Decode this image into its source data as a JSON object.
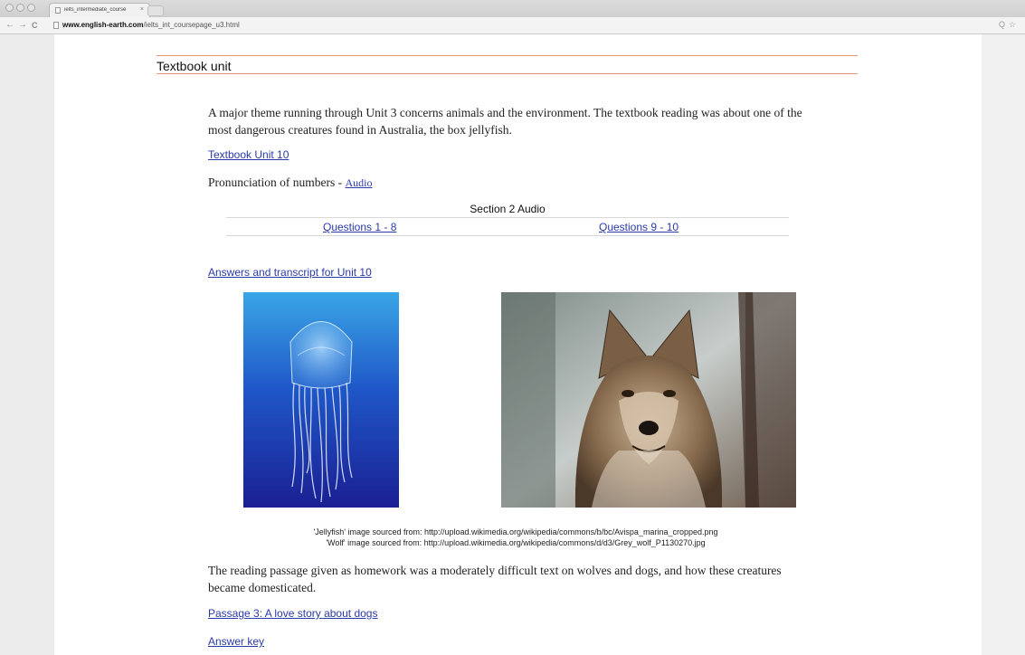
{
  "browser": {
    "tab_title": "ielts_intermediate_course",
    "tab_close": "×",
    "url_host": "www.english-earth.com",
    "url_path": "/ielts_int_coursepage_u3.html",
    "back": "←",
    "forward": "→",
    "reload": "C",
    "zoom": "Q",
    "star": "☆"
  },
  "page": {
    "heading": "Textbook unit",
    "intro": "A major theme running through Unit 3 concerns animals and the environment. The textbook reading was about one of the most dangerous creatures found in Australia, the box jellyfish.",
    "link_textbook": "Textbook Unit 10",
    "pronunciation_label": "Pronunciation of numbers - ",
    "link_audio": "Audio",
    "audio_table": {
      "caption": "Section 2 Audio",
      "cells": [
        "Questions 1 - 8",
        "Questions 9 - 10"
      ]
    },
    "link_answers": "Answers and transcript for Unit 10",
    "credit_jellyfish": "'Jellyfish' image sourced from: http://upload.wikimedia.org/wikipedia/commons/b/bc/Avispa_marina_cropped.png",
    "credit_wolf": "'Wolf' image sourced from: http://upload.wikimedia.org/wikipedia/commons/d/d3/Grey_wolf_P1130270.jpg",
    "passage_text": "The reading passage given as homework was a moderately difficult text on wolves and dogs, and how these creatures became domesticated.",
    "link_passage": "Passage 3: A love story about dogs",
    "link_answer_key": "Answer key"
  },
  "colors": {
    "link": "#2a3aa8",
    "rule": "#e8957a"
  }
}
